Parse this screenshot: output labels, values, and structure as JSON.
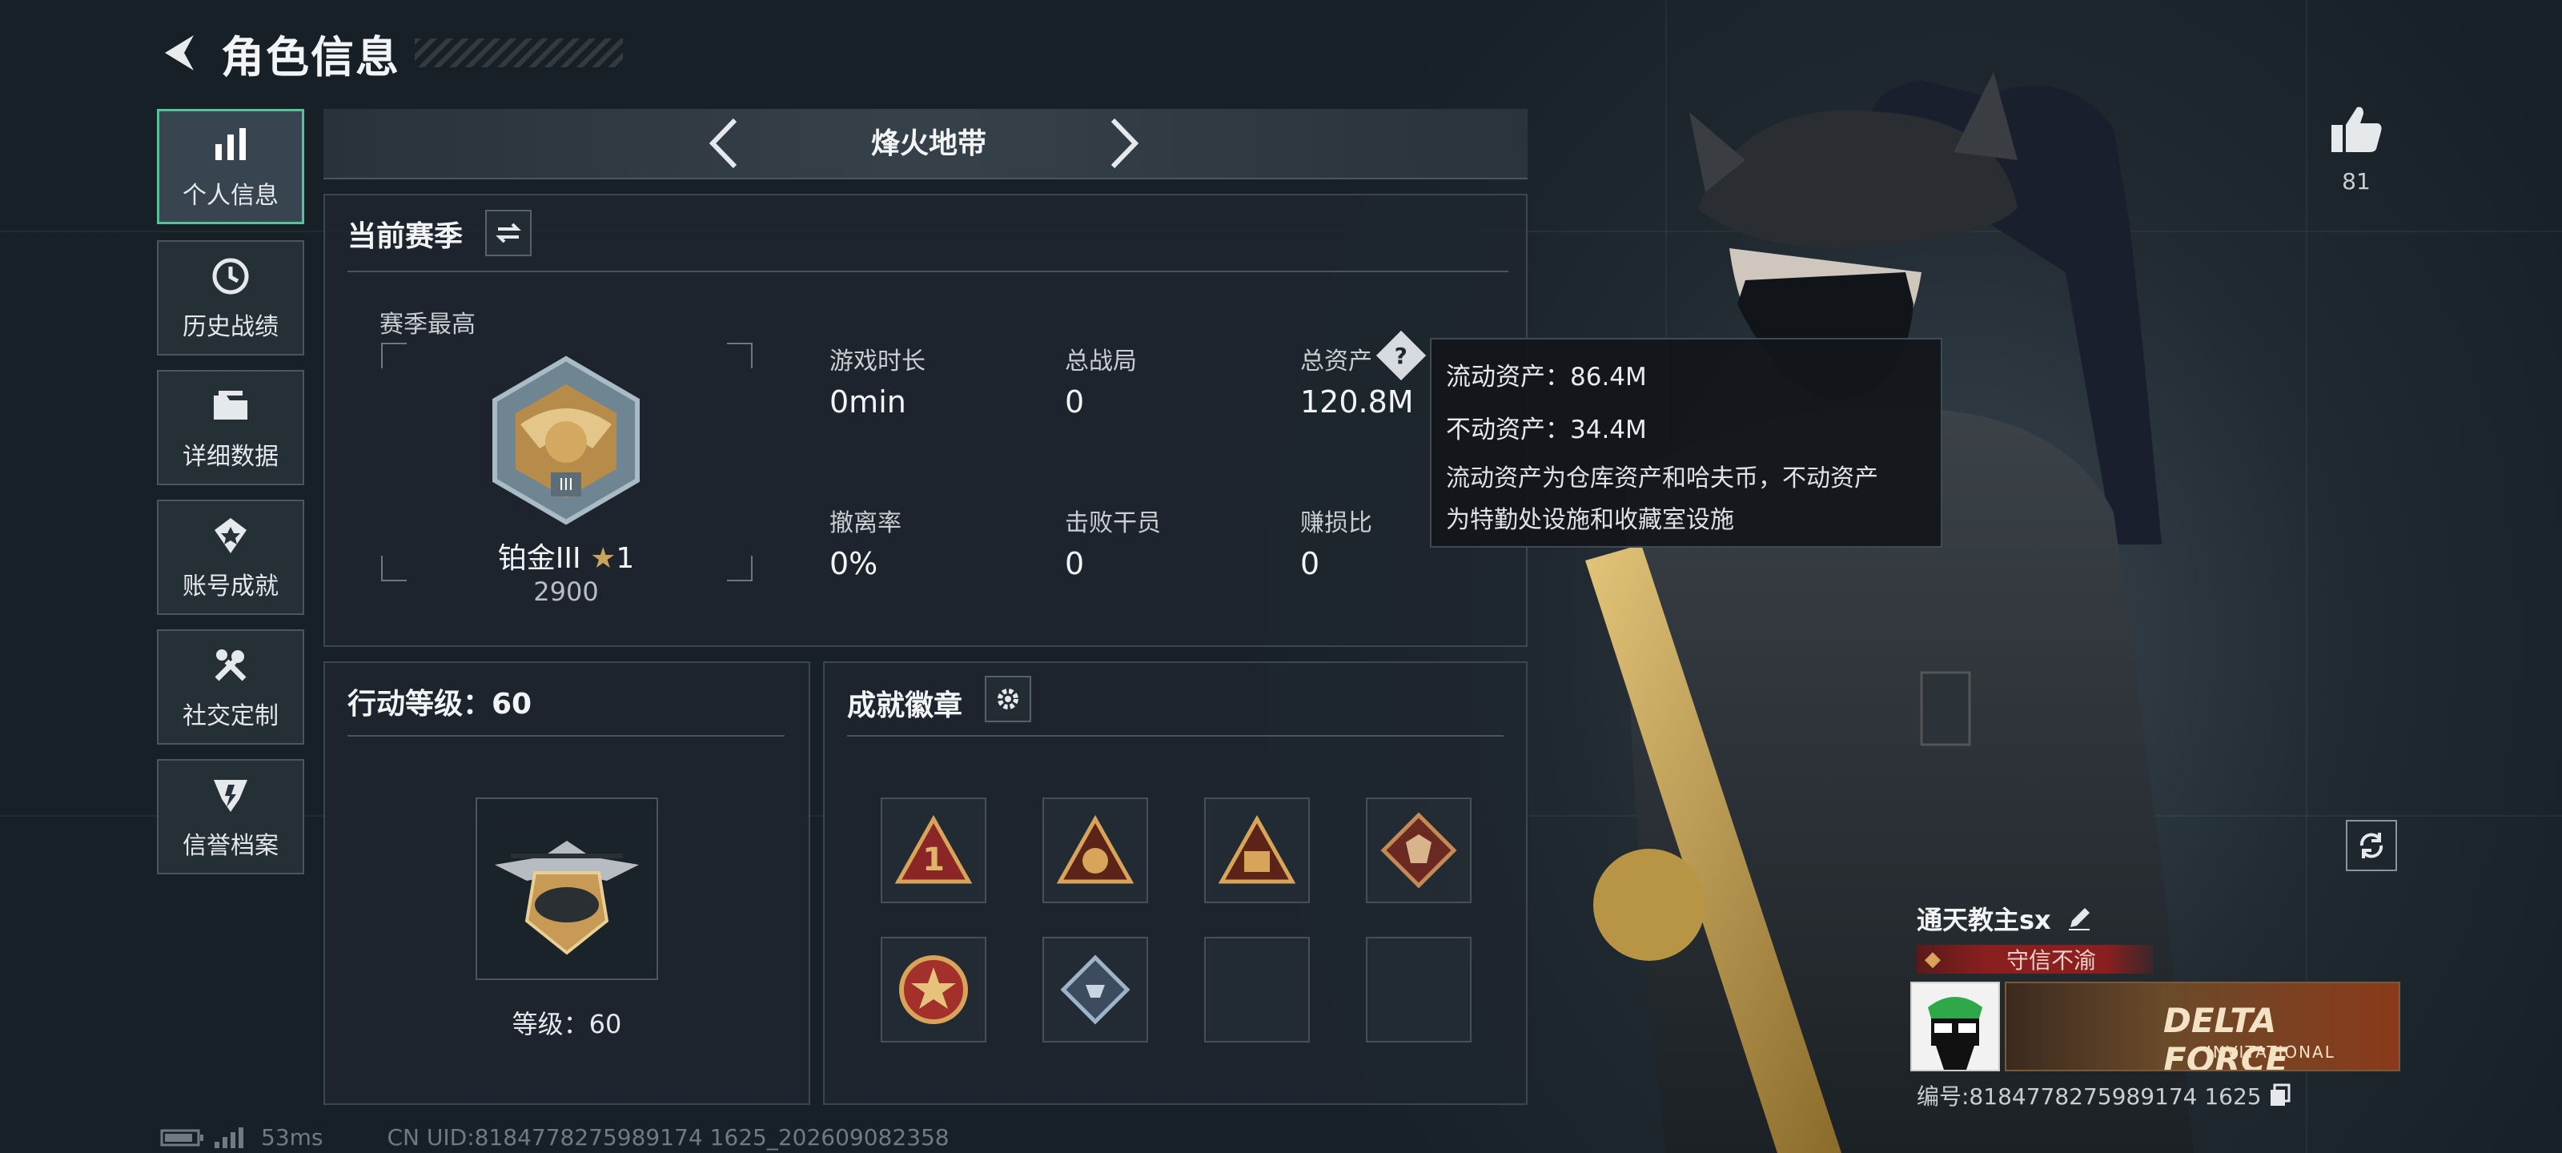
{
  "header": {
    "title": "角色信息"
  },
  "nav": [
    {
      "label": "个人信息",
      "icon": "bar-chart-icon",
      "active": true
    },
    {
      "label": "历史战绩",
      "icon": "history-clock-icon",
      "active": false
    },
    {
      "label": "详细数据",
      "icon": "folder-icon",
      "active": false
    },
    {
      "label": "账号成就",
      "icon": "achievement-icon",
      "active": false
    },
    {
      "label": "社交定制",
      "icon": "tools-icon",
      "active": false
    },
    {
      "label": "信誉档案",
      "icon": "credit-shield-icon",
      "active": false
    }
  ],
  "mode": {
    "name": "烽火地带"
  },
  "season": {
    "title": "当前赛季",
    "best_label": "赛季最高",
    "rank_name": "铂金III",
    "rank_stars": "1",
    "rank_points": "2900",
    "stats": [
      {
        "label": "游戏时长",
        "value": "0min"
      },
      {
        "label": "总战局",
        "value": "0"
      },
      {
        "label": "总资产",
        "value": "120.8M"
      },
      {
        "label": "撤离率",
        "value": "0%"
      },
      {
        "label": "击败干员",
        "value": "0"
      },
      {
        "label": "赚损比",
        "value": "0"
      }
    ]
  },
  "tooltip": {
    "liquid": "流动资产：86.4M",
    "fixed": "不动资产：34.4M",
    "desc_line1": "流动资产为仓库资产和哈夫币，不动资产",
    "desc_line2": "为特勤处设施和收藏室设施"
  },
  "level": {
    "title": "行动等级：60",
    "label": "等级：60"
  },
  "badges": {
    "title": "成就徽章",
    "items": [
      "rank-1-badge",
      "tiger-badge",
      "elephant-badge",
      "wolf-badge",
      "star-medal-badge",
      "diamond-badge",
      "empty",
      "empty"
    ]
  },
  "likes": {
    "count": "81"
  },
  "profile": {
    "name": "通天教主sx",
    "reputation": "守信不渝",
    "banner_line1": "DELTA FORCE",
    "banner_line2": "INVITATIONAL",
    "id_text": "编号:8184778275989174 1625"
  },
  "status": {
    "ping": "53ms",
    "uid": "CN UID:8184778275989174 1625_202609082358"
  },
  "colors": {
    "accent": "#55c39a",
    "reputation_bg": "#8a1f1f",
    "gold": "#c9a45a"
  }
}
